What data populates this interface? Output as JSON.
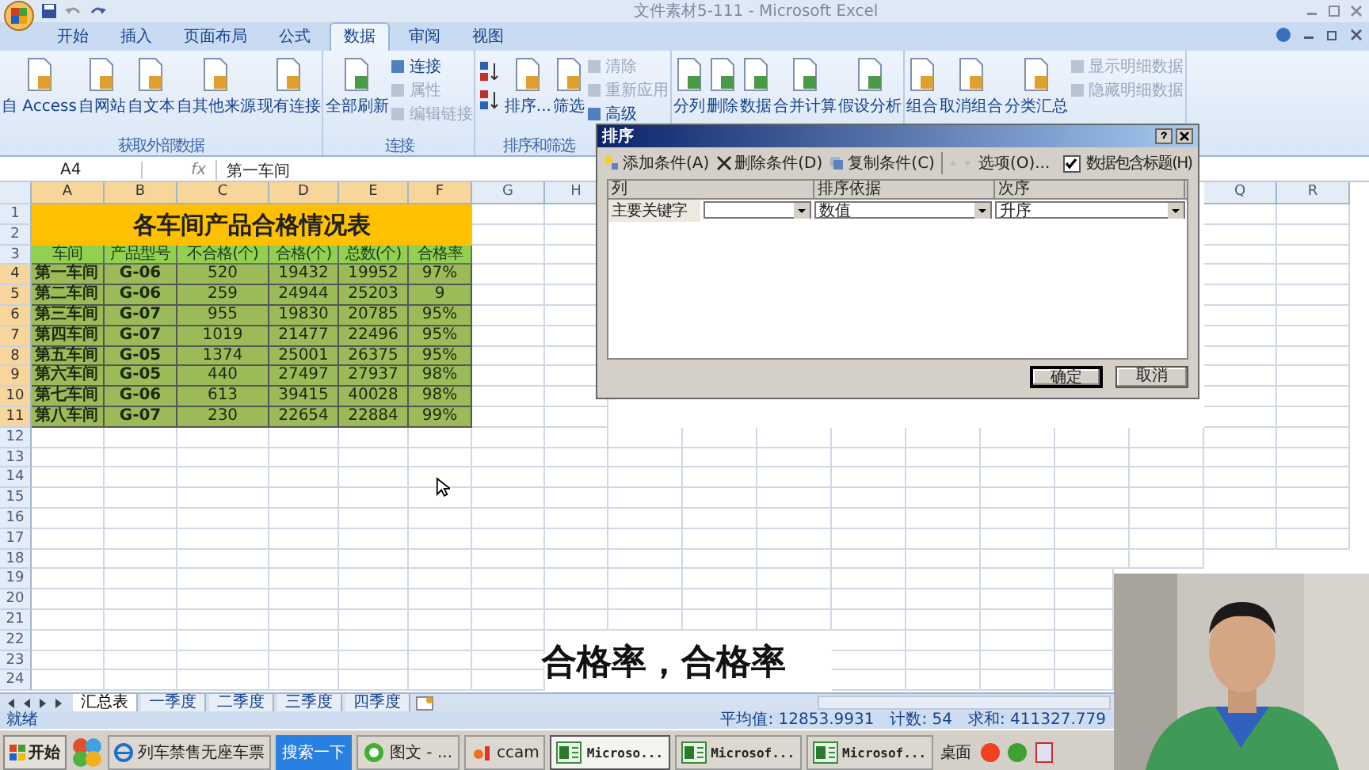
{
  "window": {
    "title": "文件素材5-111 - Microsoft Excel"
  },
  "ribbon_tabs": [
    {
      "label": "开始",
      "selected": false
    },
    {
      "label": "插入",
      "selected": false
    },
    {
      "label": "页面布局",
      "selected": false
    },
    {
      "label": "公式",
      "selected": false
    },
    {
      "label": "数据",
      "selected": true
    },
    {
      "label": "审阅",
      "selected": false
    },
    {
      "label": "视图",
      "selected": false
    }
  ],
  "ribbon_groups": [
    {
      "label": "获取外部数据",
      "items": [
        {
          "kind": "large",
          "label": "自 Access"
        },
        {
          "kind": "large",
          "label": "自网站"
        },
        {
          "kind": "large",
          "label": "自文本"
        },
        {
          "kind": "large",
          "label": "自其他来源"
        },
        {
          "kind": "large",
          "label": "现有连接"
        }
      ]
    },
    {
      "label": "连接",
      "items": [
        {
          "kind": "large",
          "label": "全部刷新"
        },
        {
          "kind": "small",
          "label": "连接",
          "disabled": false
        },
        {
          "kind": "small",
          "label": "属性",
          "disabled": true
        },
        {
          "kind": "small",
          "label": "编辑链接",
          "disabled": true
        }
      ]
    },
    {
      "label": "排序和筛选",
      "items": [
        {
          "kind": "sortpair"
        },
        {
          "kind": "large",
          "label": "排序..."
        },
        {
          "kind": "large",
          "label": "筛选"
        },
        {
          "kind": "small",
          "label": "清除",
          "disabled": true
        },
        {
          "kind": "small",
          "label": "重新应用",
          "disabled": true
        },
        {
          "kind": "small",
          "label": "高级",
          "disabled": false
        }
      ]
    },
    {
      "items": [
        {
          "kind": "large",
          "label": "分列"
        },
        {
          "kind": "large",
          "label": "删除"
        },
        {
          "kind": "large",
          "label": "数据"
        },
        {
          "kind": "large",
          "label": "合并计算"
        },
        {
          "kind": "large",
          "label": "假设分析"
        }
      ]
    },
    {
      "items": [
        {
          "kind": "large",
          "label": "组合"
        },
        {
          "kind": "large",
          "label": "取消组合"
        },
        {
          "kind": "large",
          "label": "分类汇总"
        },
        {
          "kind": "small",
          "label": "显示明细数据",
          "disabled": true
        },
        {
          "kind": "small",
          "label": "隐藏明细数据",
          "disabled": true
        }
      ]
    }
  ],
  "formula_bar": {
    "name_box": "A4",
    "fx": "fx",
    "value": "第一车间"
  },
  "sheet": {
    "columns": [
      {
        "label": "A",
        "selected": true
      },
      {
        "label": "B",
        "selected": true
      },
      {
        "label": "C",
        "selected": true
      },
      {
        "label": "D",
        "selected": true
      },
      {
        "label": "E",
        "selected": true
      },
      {
        "label": "F",
        "selected": true
      },
      {
        "label": "G",
        "selected": false
      },
      {
        "label": "H",
        "selected": false
      },
      {
        "label": "Q",
        "selected": false
      },
      {
        "label": "R",
        "selected": false
      }
    ],
    "rows": [
      {
        "label": "1",
        "selected": false
      },
      {
        "label": "2",
        "selected": false
      },
      {
        "label": "3",
        "selected": false
      },
      {
        "label": "4",
        "selected": true
      },
      {
        "label": "5",
        "selected": true
      },
      {
        "label": "6",
        "selected": true
      },
      {
        "label": "7",
        "selected": true
      },
      {
        "label": "8",
        "selected": true
      },
      {
        "label": "9",
        "selected": true
      },
      {
        "label": "10",
        "selected": true
      },
      {
        "label": "11",
        "selected": true
      },
      {
        "label": "12",
        "selected": false
      },
      {
        "label": "13",
        "selected": false
      },
      {
        "label": "14",
        "selected": false
      },
      {
        "label": "15",
        "selected": false
      },
      {
        "label": "16",
        "selected": false
      },
      {
        "label": "17",
        "selected": false
      },
      {
        "label": "18",
        "selected": false
      },
      {
        "label": "19",
        "selected": false
      },
      {
        "label": "20",
        "selected": false
      },
      {
        "label": "21",
        "selected": false
      },
      {
        "label": "22",
        "selected": false
      },
      {
        "label": "23",
        "selected": false
      },
      {
        "label": "24",
        "selected": false
      }
    ],
    "title": "各车间产品合格情况表",
    "header": [
      "车间",
      "产品型号",
      "不合格(个)",
      "合格(个)",
      "总数(个)",
      "合格率"
    ],
    "data": [
      [
        "第一车间",
        "G-06",
        "520",
        "19432",
        "19952",
        "97%"
      ],
      [
        "第二车间",
        "G-06",
        "259",
        "24944",
        "25203",
        "9"
      ],
      [
        "第三车间",
        "G-07",
        "955",
        "19830",
        "20785",
        "95%"
      ],
      [
        "第四车间",
        "G-07",
        "1019",
        "21477",
        "22496",
        "95%"
      ],
      [
        "第五车间",
        "G-05",
        "1374",
        "25001",
        "26375",
        "95%"
      ],
      [
        "第六车间",
        "G-05",
        "440",
        "27497",
        "27937",
        "98%"
      ],
      [
        "第七车间",
        "G-06",
        "613",
        "39415",
        "40028",
        "98%"
      ],
      [
        "第八车间",
        "G-07",
        "230",
        "22654",
        "22884",
        "99%"
      ]
    ]
  },
  "sheet_tabs": [
    {
      "label": "汇总表",
      "selected": true
    },
    {
      "label": "一季度",
      "selected": false
    },
    {
      "label": "二季度",
      "selected": false
    },
    {
      "label": "三季度",
      "selected": false
    },
    {
      "label": "四季度",
      "selected": false
    }
  ],
  "status_bar": {
    "ready": "就绪",
    "average": "平均值: 12853.9931",
    "count": "计数: 54",
    "sum": "求和: 411327.779"
  },
  "taskbar": {
    "start": "开始",
    "items": [
      {
        "kind": "ie",
        "label": "列车禁售无座车票",
        "selected": false
      },
      {
        "kind": "search",
        "label": "搜索一下",
        "selected": false
      },
      {
        "kind": "browser",
        "label": "图文 - ...",
        "selected": false
      },
      {
        "kind": "app",
        "label": "ccam",
        "selected": false
      },
      {
        "kind": "excel",
        "label": "Microso...",
        "selected": true
      },
      {
        "kind": "excel",
        "label": "Microsof...",
        "selected": false
      },
      {
        "kind": "excel",
        "label": "Microsof...",
        "selected": false
      }
    ],
    "desktop": "桌面"
  },
  "sort_dialog": {
    "title": "排序",
    "toolbar": [
      {
        "kind": "add",
        "label": "添加条件(A)"
      },
      {
        "kind": "delete",
        "label": "删除条件(D)"
      },
      {
        "kind": "copy",
        "label": "复制条件(C)"
      },
      {
        "kind": "up"
      },
      {
        "kind": "down"
      },
      {
        "kind": "options",
        "label": "选项(O)..."
      }
    ],
    "header_checkbox": {
      "label": "数据包含标题(H)",
      "checked": true
    },
    "columns": [
      "列",
      "排序依据",
      "次序"
    ],
    "levels": [
      {
        "label": "主要关键字",
        "sort_on": "数值",
        "order": "升序"
      }
    ],
    "buttons": [
      "确定",
      "取消"
    ]
  },
  "subtitle": "合格率，合格率"
}
